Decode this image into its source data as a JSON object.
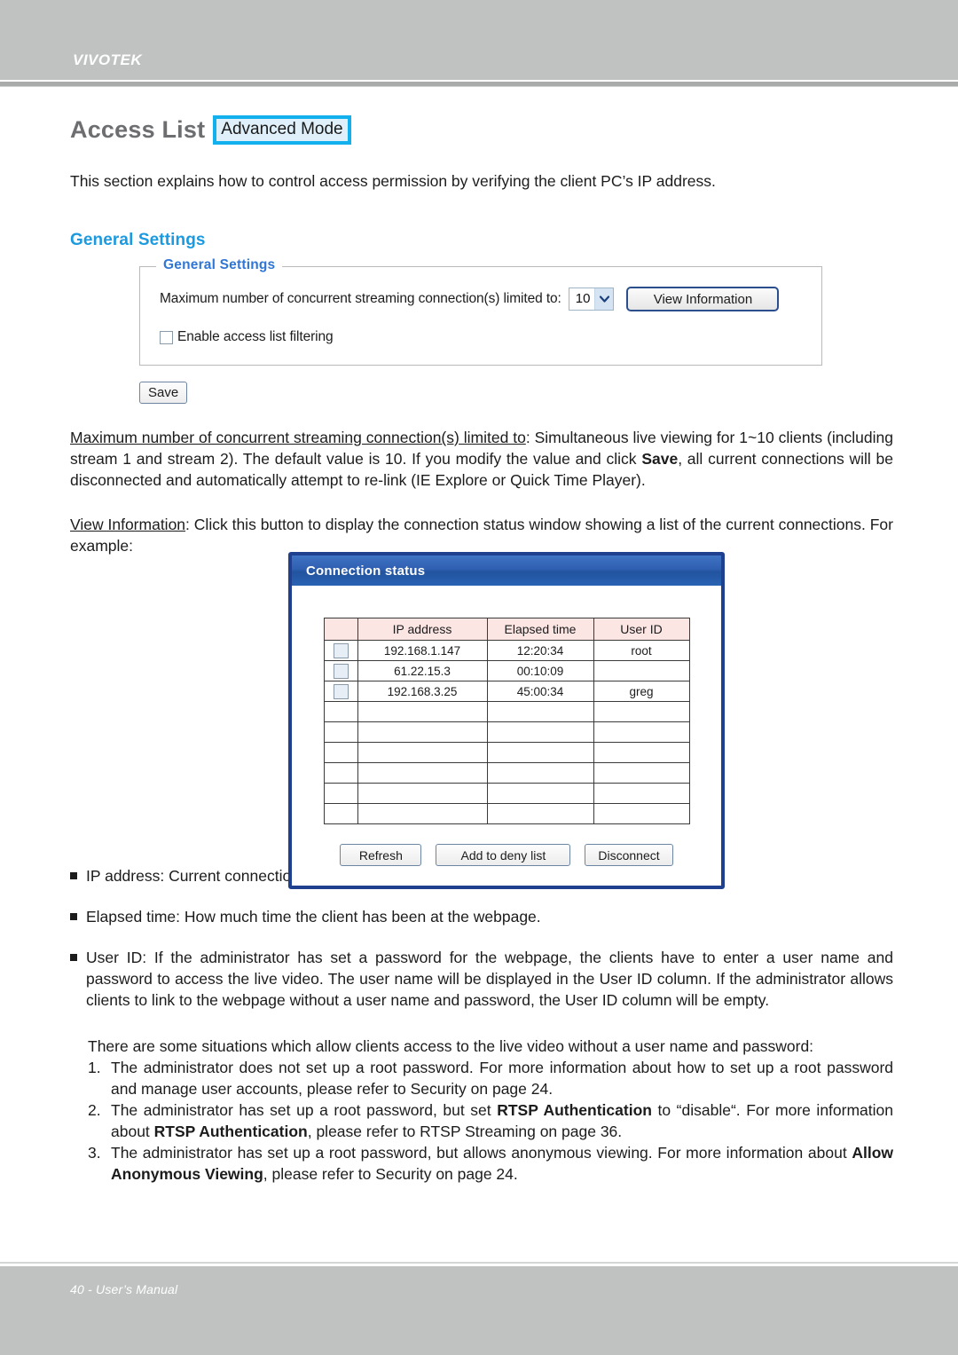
{
  "header": {
    "brand": "VIVOTEK"
  },
  "page": {
    "title": "Access List",
    "mode_badge": "Advanced Mode",
    "intro": "This section explains how to control access permission by verifying the client PC’s IP address.",
    "section_title": "General Settings"
  },
  "settings_panel": {
    "legend": "General Settings",
    "max_conn_label": "Maximum number of concurrent streaming connection(s) limited to:",
    "max_conn_value": "10",
    "dropdown_icon": "chevron-down-icon",
    "view_information_label": "View Information",
    "enable_filtering_label": "Enable access list filtering",
    "enable_filtering_checked": false,
    "save_label": "Save"
  },
  "descriptions": {
    "max_conn": {
      "term": "Maximum number of concurrent streaming connection(s) limited to",
      "text_1": ": Simultaneous live viewing for 1~10 clients (including stream 1 and stream 2). The default value is 10. If you modify the value and click ",
      "bold_1": "Save",
      "text_2": ", all current connections will be disconnected and automatically attempt to re-link (IE Explore or Quick Time Player)."
    },
    "view_information": {
      "term": "View Information",
      "text_1": ": Click this button to display the connection status window showing a list of the current connections. For example:"
    }
  },
  "dialog": {
    "title": "Connection status",
    "columns": [
      "",
      "IP address",
      "Elapsed time",
      "User ID"
    ],
    "rows": [
      {
        "checkbox": true,
        "ip": "192.168.1.147",
        "elapsed": "12:20:34",
        "user_id": "root"
      },
      {
        "checkbox": true,
        "ip": "61.22.15.3",
        "elapsed": "00:10:09",
        "user_id": ""
      },
      {
        "checkbox": true,
        "ip": "192.168.3.25",
        "elapsed": "45:00:34",
        "user_id": "greg"
      }
    ],
    "empty_row_count": 6,
    "buttons": {
      "refresh": "Refresh",
      "add_to_deny_list": "Add to deny list",
      "disconnect": "Disconnect"
    }
  },
  "bullets": [
    {
      "text": "IP address: Current connections to the Network Camera."
    },
    {
      "text": "Elapsed time: How much time the client has been at the webpage."
    },
    {
      "text": "User ID: If the administrator has set a password for the webpage, the clients have to enter a user name and password to access the live video. The user name will be displayed in the User ID column. If the administrator allows clients to link to the webpage without a user name and password, the User ID column will be empty."
    }
  ],
  "notes": {
    "intro": "There are some situations which allow clients access to the live video without a user name and password:",
    "items": [
      {
        "seg1": "The administrator does not set up a root password. For more information about how to set up a root password and manage user accounts, please refer to Security on page 24.",
        "bold1": "",
        "seg2": "",
        "bold2": "",
        "seg3": ""
      },
      {
        "seg1": "The administrator has set up a root password, but set ",
        "bold1": "RTSP Authentication",
        "seg2": " to “disable“. For more information about ",
        "bold2": "RTSP Authentication",
        "seg3": ", please refer to RTSP Streaming on page 36."
      },
      {
        "seg1": "The administrator has set up a root password, but allows anonymous viewing. For more information about ",
        "bold1": "Allow Anonymous Viewing",
        "seg2": ", please refer to Security on page 24.",
        "bold2": "",
        "seg3": ""
      }
    ]
  },
  "footer": {
    "text": "40 - User’s Manual"
  }
}
